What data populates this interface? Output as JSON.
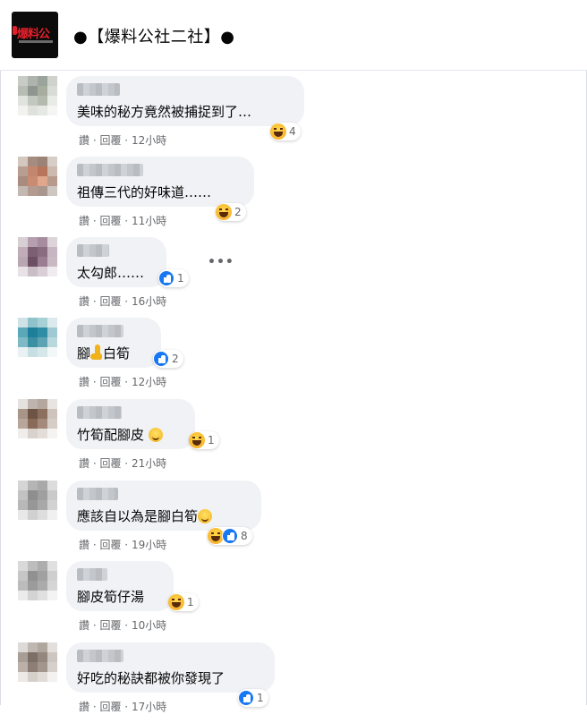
{
  "page": {
    "name": "●【爆料公社二社】●",
    "logo_text": "爆料公"
  },
  "actions": {
    "like": "讚",
    "reply": "回覆",
    "sep": " · "
  },
  "comments": [
    {
      "text": "美味的秘方竟然被捕捉到了…",
      "time": "12小時",
      "reaction_type": "haha",
      "reaction_count": "4"
    },
    {
      "text": "祖傳三代的好味道……",
      "time": "11小時",
      "reaction_type": "haha",
      "reaction_count": "2"
    },
    {
      "text": "太勾郎……",
      "time": "16小時",
      "reaction_type": "like",
      "reaction_count": "1"
    },
    {
      "text": "腳",
      "text_after": "白筍",
      "time": "12小時",
      "reaction_type": "like",
      "reaction_count": "2"
    },
    {
      "text": "竹筍配腳皮",
      "time": "21小時",
      "reaction_type": "haha",
      "reaction_count": "1"
    },
    {
      "text": "應該自以為是腳白筍",
      "time": "19小時",
      "reaction_type": "haha+like",
      "reaction_count": "8"
    },
    {
      "text": "腳皮筍仔湯",
      "time": "10小時",
      "reaction_type": "haha",
      "reaction_count": "1"
    },
    {
      "text": "好吃的秘訣都被你發現了",
      "time": "17小時",
      "reaction_type": "like",
      "reaction_count": "1"
    }
  ],
  "more_options": "•••",
  "colors": {
    "bubble": "#f0f2f5",
    "meta": "#65676b",
    "like_blue": "#1877f2",
    "haha_yellow": "#f7b928"
  },
  "icons": {
    "reaction_haha": "haha-emoji-icon",
    "reaction_like": "like-icon",
    "more": "more-options-icon"
  }
}
